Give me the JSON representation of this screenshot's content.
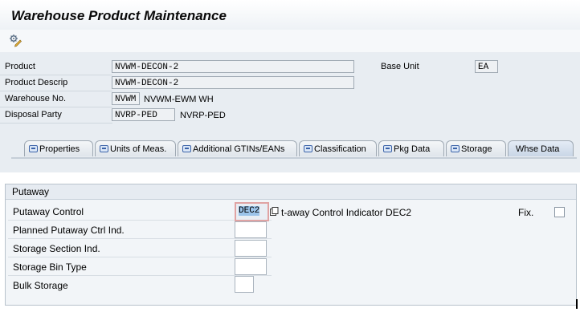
{
  "window": {
    "title": "Warehouse Product Maintenance"
  },
  "toolbar": {
    "icon": "display-change-icon"
  },
  "header": {
    "product_label": "Product",
    "product_value": "NVWM-DECON-2",
    "base_unit_label": "Base Unit",
    "base_unit_value": "EA",
    "product_descrip_label": "Product Descrip",
    "product_descrip_value": "NVWM-DECON-2",
    "warehouse_label": "Warehouse No.",
    "warehouse_value": "NVWM",
    "warehouse_text": "NVWM-EWM WH",
    "disposal_label": "Disposal Party",
    "disposal_value": "NVRP-PED",
    "disposal_text": "NVRP-PED"
  },
  "tabs": [
    {
      "label": "Properties"
    },
    {
      "label": "Units of Meas."
    },
    {
      "label": "Additional GTINs/EANs"
    },
    {
      "label": "Classification"
    },
    {
      "label": "Pkg Data"
    },
    {
      "label": "Storage"
    },
    {
      "label": "Whse Data"
    }
  ],
  "putaway": {
    "title": "Putaway",
    "putaway_control_label": "Putaway Control",
    "putaway_control_value": "DEC2",
    "putaway_control_desc": "t-away Control Indicator DEC2",
    "fix_label": "Fix.",
    "planned_label": "Planned Putaway Ctrl Ind.",
    "planned_value": "",
    "section_label": "Storage Section Ind.",
    "section_value": "",
    "bin_type_label": "Storage Bin Type",
    "bin_type_value": "",
    "bulk_label": "Bulk Storage",
    "bulk_value": ""
  }
}
